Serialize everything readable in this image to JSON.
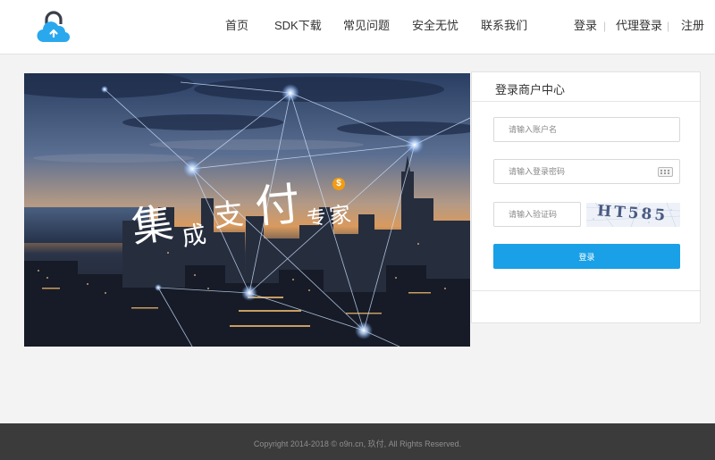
{
  "header": {
    "logo_icon": "cloud-lock-upload-icon",
    "nav": [
      {
        "label": "首页"
      },
      {
        "label": "SDK下载"
      },
      {
        "label": "常见问题"
      },
      {
        "label": "安全无忧"
      },
      {
        "label": "联系我们"
      }
    ],
    "auth": {
      "login": "登录",
      "agent_login": "代理登录",
      "register": "注册",
      "separator": "|"
    }
  },
  "banner": {
    "headline_chars": [
      "集",
      "成",
      "支",
      "付",
      "专",
      "家"
    ],
    "coin_symbol": "$"
  },
  "login_panel": {
    "title": "登录商户中心",
    "username_placeholder": "请输入账户名",
    "password_placeholder": "请输入登录密码",
    "captcha_placeholder": "请输入验证码",
    "captcha_text": "HT585",
    "keyboard_icon": "keyboard-icon",
    "submit_label": "登录"
  },
  "footer": {
    "copyright": "Copyright 2014-2018 © o9n.cn, 玖付, All Rights Reserved."
  },
  "colors": {
    "accent": "#1aa0e6",
    "logo_blue": "#29a8ee",
    "footer_bg": "#3b3b3b",
    "coin": "#f39c12"
  }
}
